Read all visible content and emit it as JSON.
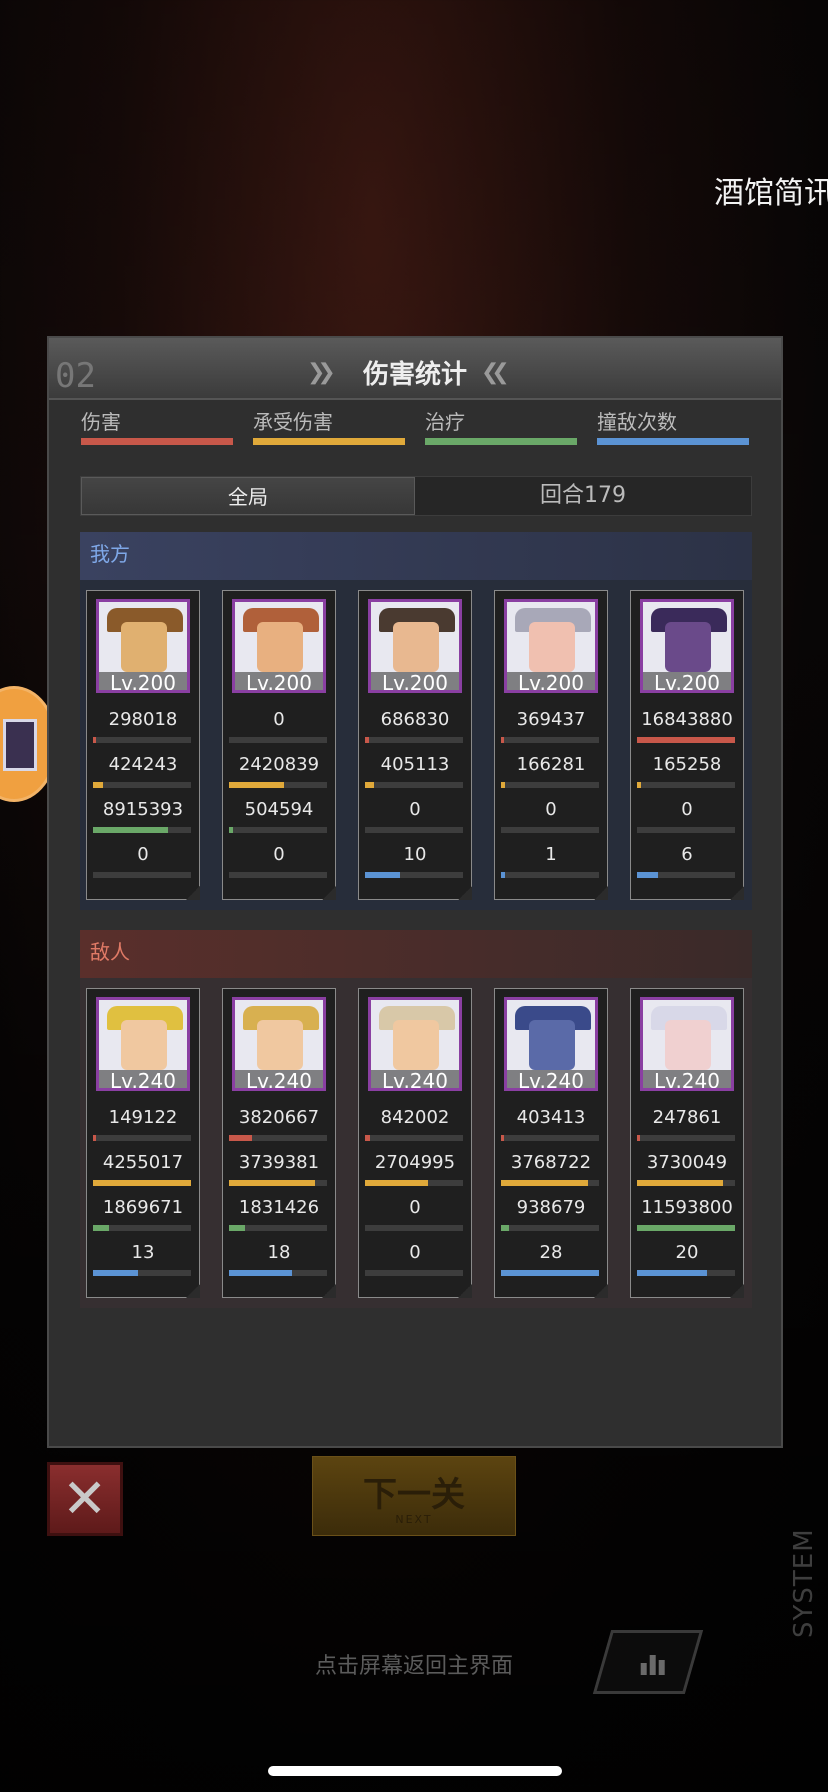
{
  "background_text": "酒馆简讯",
  "panel": {
    "number": "02",
    "title": "伤害统计",
    "categories": [
      {
        "label": "伤害",
        "color": "#c8584a"
      },
      {
        "label": "承受伤害",
        "color": "#e0a93a"
      },
      {
        "label": "治疗",
        "color": "#6aa868"
      },
      {
        "label": "撞敌次数",
        "color": "#5b93d4"
      }
    ],
    "tabs": {
      "overall": "全局",
      "round": "回合179"
    },
    "watermark": "SYSTEM"
  },
  "allies": {
    "label": "我方",
    "units": [
      {
        "level": "Lv.200",
        "damage": "298018",
        "taken": "424243",
        "heal": "8915393",
        "hits": "0",
        "damage_ratio": 0.02,
        "taken_ratio": 0.1,
        "heal_ratio": 0.77,
        "hits_ratio": 0.0,
        "hat": "#8a5a2a",
        "skin": "#e0b070"
      },
      {
        "level": "Lv.200",
        "damage": "0",
        "taken": "2420839",
        "heal": "504594",
        "hits": "0",
        "damage_ratio": 0.0,
        "taken_ratio": 0.56,
        "heal_ratio": 0.04,
        "hits_ratio": 0.0,
        "hat": "#b0603a",
        "skin": "#e8b080"
      },
      {
        "level": "Lv.200",
        "damage": "686830",
        "taken": "405113",
        "heal": "0",
        "hits": "10",
        "damage_ratio": 0.04,
        "taken_ratio": 0.09,
        "heal_ratio": 0.0,
        "hits_ratio": 0.36,
        "hat": "#4a3a30",
        "skin": "#e8b890"
      },
      {
        "level": "Lv.200",
        "damage": "369437",
        "taken": "166281",
        "heal": "0",
        "hits": "1",
        "damage_ratio": 0.02,
        "taken_ratio": 0.04,
        "heal_ratio": 0.0,
        "hits_ratio": 0.04,
        "hat": "#a8a8b8",
        "skin": "#f0c0b0"
      },
      {
        "level": "Lv.200",
        "damage": "16843880",
        "taken": "165258",
        "heal": "0",
        "hits": "6",
        "damage_ratio": 1.0,
        "taken_ratio": 0.04,
        "heal_ratio": 0.0,
        "hits_ratio": 0.21,
        "hat": "#3a2a5a",
        "skin": "#6a4a8a"
      }
    ]
  },
  "enemies": {
    "label": "敌人",
    "units": [
      {
        "level": "Lv.240",
        "damage": "149122",
        "taken": "4255017",
        "heal": "1869671",
        "hits": "13",
        "damage_ratio": 0.01,
        "taken_ratio": 1.0,
        "heal_ratio": 0.16,
        "hits_ratio": 0.46,
        "hat": "#e0c040",
        "skin": "#f0c8a0"
      },
      {
        "level": "Lv.240",
        "damage": "3820667",
        "taken": "3739381",
        "heal": "1831426",
        "hits": "18",
        "damage_ratio": 0.23,
        "taken_ratio": 0.88,
        "heal_ratio": 0.16,
        "hits_ratio": 0.64,
        "hat": "#d8b050",
        "skin": "#f0c8a0"
      },
      {
        "level": "Lv.240",
        "damage": "842002",
        "taken": "2704995",
        "heal": "0",
        "hits": "0",
        "damage_ratio": 0.05,
        "taken_ratio": 0.64,
        "heal_ratio": 0.0,
        "hits_ratio": 0.0,
        "hat": "#d8c8a8",
        "skin": "#f0c8a0"
      },
      {
        "level": "Lv.240",
        "damage": "403413",
        "taken": "3768722",
        "heal": "938679",
        "hits": "28",
        "damage_ratio": 0.02,
        "taken_ratio": 0.89,
        "heal_ratio": 0.08,
        "hits_ratio": 1.0,
        "hat": "#3a4a8a",
        "skin": "#5a6aa8"
      },
      {
        "level": "Lv.240",
        "damage": "247861",
        "taken": "3730049",
        "heal": "11593800",
        "hits": "20",
        "damage_ratio": 0.01,
        "taken_ratio": 0.88,
        "heal_ratio": 1.0,
        "hits_ratio": 0.71,
        "hat": "#d8d8e8",
        "skin": "#f0d0d0"
      }
    ]
  },
  "buttons": {
    "next_main": "下一关",
    "next_sub": "NEXT",
    "close_icon": "close-x-icon",
    "stats_icon": "bar-chart-icon"
  },
  "hint": "点击屏幕返回主界面"
}
